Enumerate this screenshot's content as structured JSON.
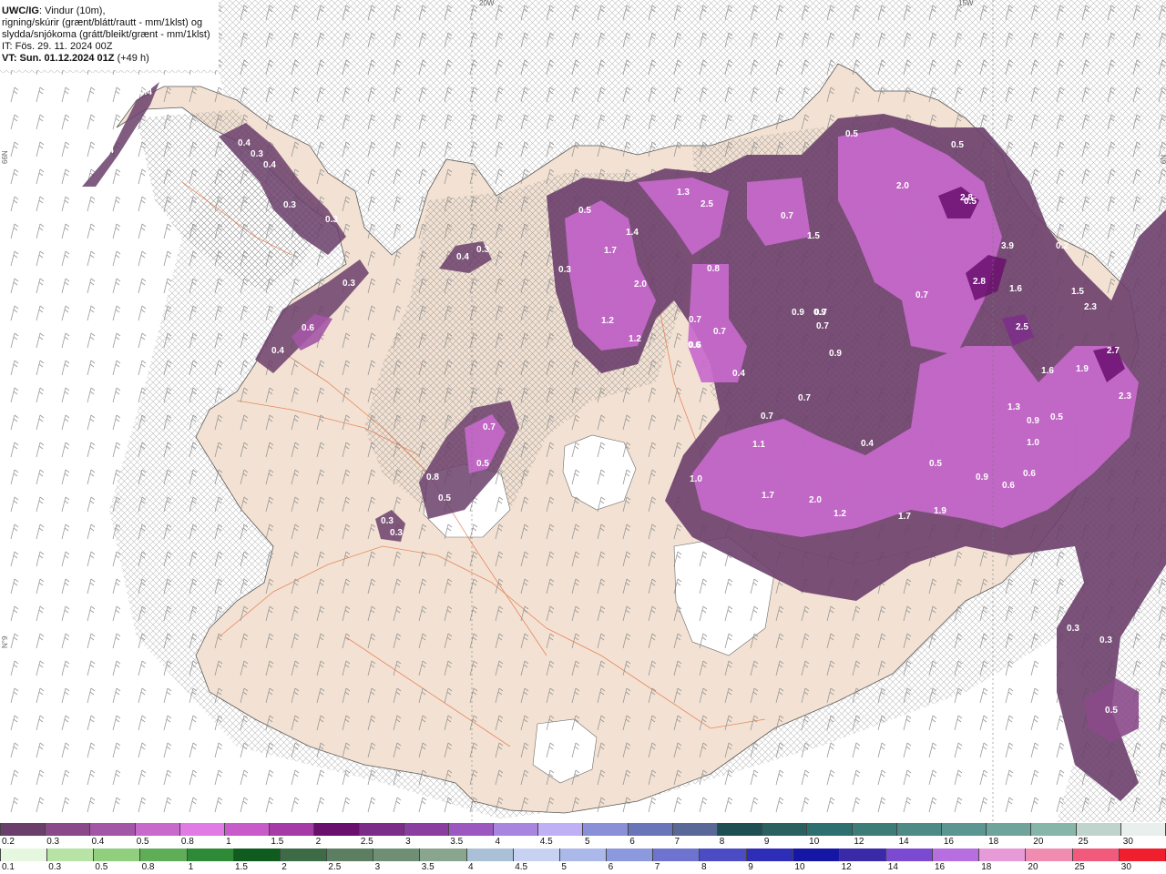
{
  "info": {
    "line1_bold": "UWC/IG",
    "line1_rest": ": Vindur (10m),",
    "line2": "rigning/skúrir (grænt/blátt/rautt - mm/1klst) og",
    "line3": "slydda/snjókoma (grátt/bleikt/grænt - mm/1klst)",
    "line4": "IT: Fös. 29. 11. 2024 00Z",
    "line5_bold": "VT: Sun. 01.12.2024 01Z",
    "line5_rest": " (+49 h)"
  },
  "graticule": {
    "top_labels": [
      "20W",
      "15W"
    ],
    "left_labels": [
      "66N",
      "N°9"
    ],
    "right_label": "N9"
  },
  "precip_labels": [
    {
      "v": "0.4"
    },
    {
      "v": "0.4"
    },
    {
      "v": "0.4"
    },
    {
      "v": "0.3"
    },
    {
      "v": "0.4"
    },
    {
      "v": "0.3"
    },
    {
      "v": "0.3"
    },
    {
      "v": "0.3"
    },
    {
      "v": "0.6"
    },
    {
      "v": "0.4"
    },
    {
      "v": "0.4"
    },
    {
      "v": "0.3"
    },
    {
      "v": "0.7"
    },
    {
      "v": "0.5"
    },
    {
      "v": "0.8"
    },
    {
      "v": "0.5"
    },
    {
      "v": "0.3"
    },
    {
      "v": "0.3"
    },
    {
      "v": "0.5"
    },
    {
      "v": "1.7"
    },
    {
      "v": "1.4"
    },
    {
      "v": "0.3"
    },
    {
      "v": "2.0"
    },
    {
      "v": "1.2"
    },
    {
      "v": "1.2"
    },
    {
      "v": "1.3"
    },
    {
      "v": "2.5"
    },
    {
      "v": "0.8"
    },
    {
      "v": "0.7"
    },
    {
      "v": "0.6"
    },
    {
      "v": "0.7"
    },
    {
      "v": "0.4"
    },
    {
      "v": "0.9"
    },
    {
      "v": "0.7"
    },
    {
      "v": "0.7"
    },
    {
      "v": "1.5"
    },
    {
      "v": "0.7"
    },
    {
      "v": "0.9"
    },
    {
      "v": "0.9"
    },
    {
      "v": "0.5"
    },
    {
      "v": "0.5"
    },
    {
      "v": "2.0"
    },
    {
      "v": "2.8"
    },
    {
      "v": "0.5"
    },
    {
      "v": "3.9"
    },
    {
      "v": "0.2"
    },
    {
      "v": "0.7"
    },
    {
      "v": "2.8"
    },
    {
      "v": "1.6"
    },
    {
      "v": "1.5"
    },
    {
      "v": "2.3"
    },
    {
      "v": "2.5"
    },
    {
      "v": "2.7"
    },
    {
      "v": "1.6"
    },
    {
      "v": "1.9"
    },
    {
      "v": "2.3"
    },
    {
      "v": "0.7"
    },
    {
      "v": "0.7"
    },
    {
      "v": "0.6"
    },
    {
      "v": "1.1"
    },
    {
      "v": "0.4"
    },
    {
      "v": "1.3"
    },
    {
      "v": "0.9"
    },
    {
      "v": "0.5"
    },
    {
      "v": "1.0"
    },
    {
      "v": "1.0"
    },
    {
      "v": "0.5"
    },
    {
      "v": "0.9"
    },
    {
      "v": "0.6"
    },
    {
      "v": "0.6"
    },
    {
      "v": "1.7"
    },
    {
      "v": "2.0"
    },
    {
      "v": "1.2"
    },
    {
      "v": "1.7"
    },
    {
      "v": "1.9"
    },
    {
      "v": "0.3"
    },
    {
      "v": "0.3"
    },
    {
      "v": "0.5"
    }
  ],
  "legend_top": {
    "labels": [
      "0.2",
      "0.3",
      "0.4",
      "0.5",
      "0.8",
      "1",
      "1.5",
      "2",
      "2.5",
      "3",
      "3.5",
      "4",
      "4.5",
      "5",
      "6",
      "7",
      "8",
      "9",
      "10",
      "12",
      "14",
      "16",
      "18",
      "20",
      "25",
      "30"
    ],
    "colors": [
      "#6b3f6b",
      "#8a4a8a",
      "#a456a6",
      "#c869cc",
      "#e07be6",
      "#c95ac9",
      "#a63aa6",
      "#6a0f6e",
      "#7c2d8a",
      "#8a3fa0",
      "#9a58c0",
      "#a886e0",
      "#bfb0f5",
      "#8a90d8",
      "#6a74b8",
      "#5a6898",
      "#1e4f52",
      "#2a6060",
      "#2e7070",
      "#3e7c78",
      "#4e8a86",
      "#5c9690",
      "#6ea49c",
      "#86b6aa",
      "#bfd4cc",
      "#e8efec"
    ]
  },
  "legend_bottom": {
    "labels": [
      "0.1",
      "0.3",
      "0.5",
      "0.8",
      "1",
      "1.5",
      "2",
      "2.5",
      "3",
      "3.5",
      "4",
      "4.5",
      "5",
      "6",
      "7",
      "8",
      "9",
      "10",
      "12",
      "14",
      "16",
      "18",
      "20",
      "25",
      "30"
    ],
    "colors": [
      "#e6f7df",
      "#b7e3a6",
      "#8fcf7e",
      "#5fae57",
      "#2f8a38",
      "#0f5c1e",
      "#3d6b46",
      "#5c7f62",
      "#6f8f74",
      "#8aa58e",
      "#a9c0d6",
      "#c7d2f2",
      "#aab8ea",
      "#8c99dc",
      "#6d73cf",
      "#4b4bc3",
      "#2d2db8",
      "#1515a6",
      "#3a2aa8",
      "#7a4ad0",
      "#b66ee0",
      "#e79ad8",
      "#f08cb0",
      "#f25a7c",
      "#ef1f2e"
    ]
  }
}
